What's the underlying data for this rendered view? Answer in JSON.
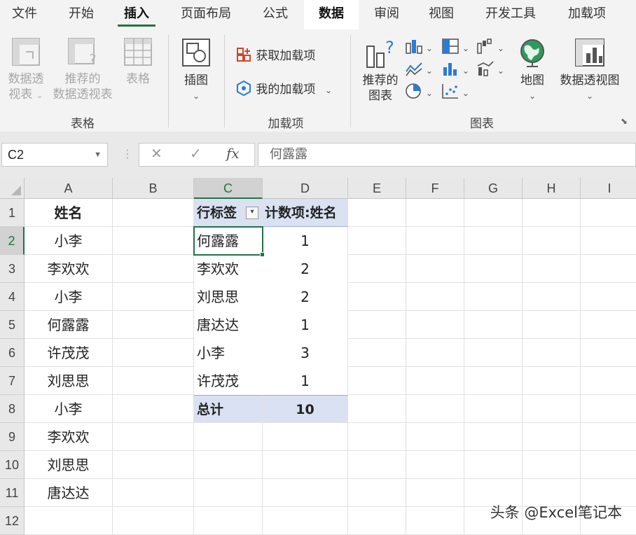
{
  "tabs": {
    "file": "文件",
    "home": "开始",
    "insert": "插入",
    "layout": "页面布局",
    "formulas": "公式",
    "data": "数据",
    "review": "审阅",
    "view": "视图",
    "developer": "开发工具",
    "addins": "加载项"
  },
  "ribbon": {
    "pivot_table": [
      "数据透",
      "视表"
    ],
    "recommended_pivot": [
      "推荐的",
      "数据透视表"
    ],
    "table": "表格",
    "illustrations": "插图",
    "get_addins": "获取加载项",
    "my_addins": "我的加载项",
    "recommended_charts": [
      "推荐的",
      "图表"
    ],
    "maps": "地图",
    "pivot_chart": "数据透视图",
    "groups": {
      "tables": "表格",
      "addins": "加载项",
      "charts": "图表"
    }
  },
  "formula_bar": {
    "name_box": "C2",
    "fx": "fx",
    "value": "何露露"
  },
  "sheet": {
    "columns": [
      "A",
      "B",
      "C",
      "D",
      "E",
      "F",
      "G",
      "H",
      "I"
    ],
    "rows": [
      "1",
      "2",
      "3",
      "4",
      "5",
      "6",
      "7",
      "8",
      "9",
      "10",
      "11",
      "12"
    ],
    "col_a": [
      "姓名",
      "小李",
      "李欢欢",
      "小李",
      "何露露",
      "许茂茂",
      "刘思思",
      "小李",
      "李欢欢",
      "刘思思",
      "唐达达",
      ""
    ],
    "pivot": {
      "header_label": "行标签",
      "header_value": "计数项:姓名",
      "rows": [
        {
          "label": "何露露",
          "value": "1"
        },
        {
          "label": "李欢欢",
          "value": "2"
        },
        {
          "label": "刘思思",
          "value": "2"
        },
        {
          "label": "唐达达",
          "value": "1"
        },
        {
          "label": "小李",
          "value": "3"
        },
        {
          "label": "许茂茂",
          "value": "1"
        }
      ],
      "total_label": "总计",
      "total_value": "10"
    }
  },
  "watermark": "头条 @Excel笔记本",
  "colors": {
    "accent": "#217346",
    "pivot_fill": "#d9e1f2"
  }
}
